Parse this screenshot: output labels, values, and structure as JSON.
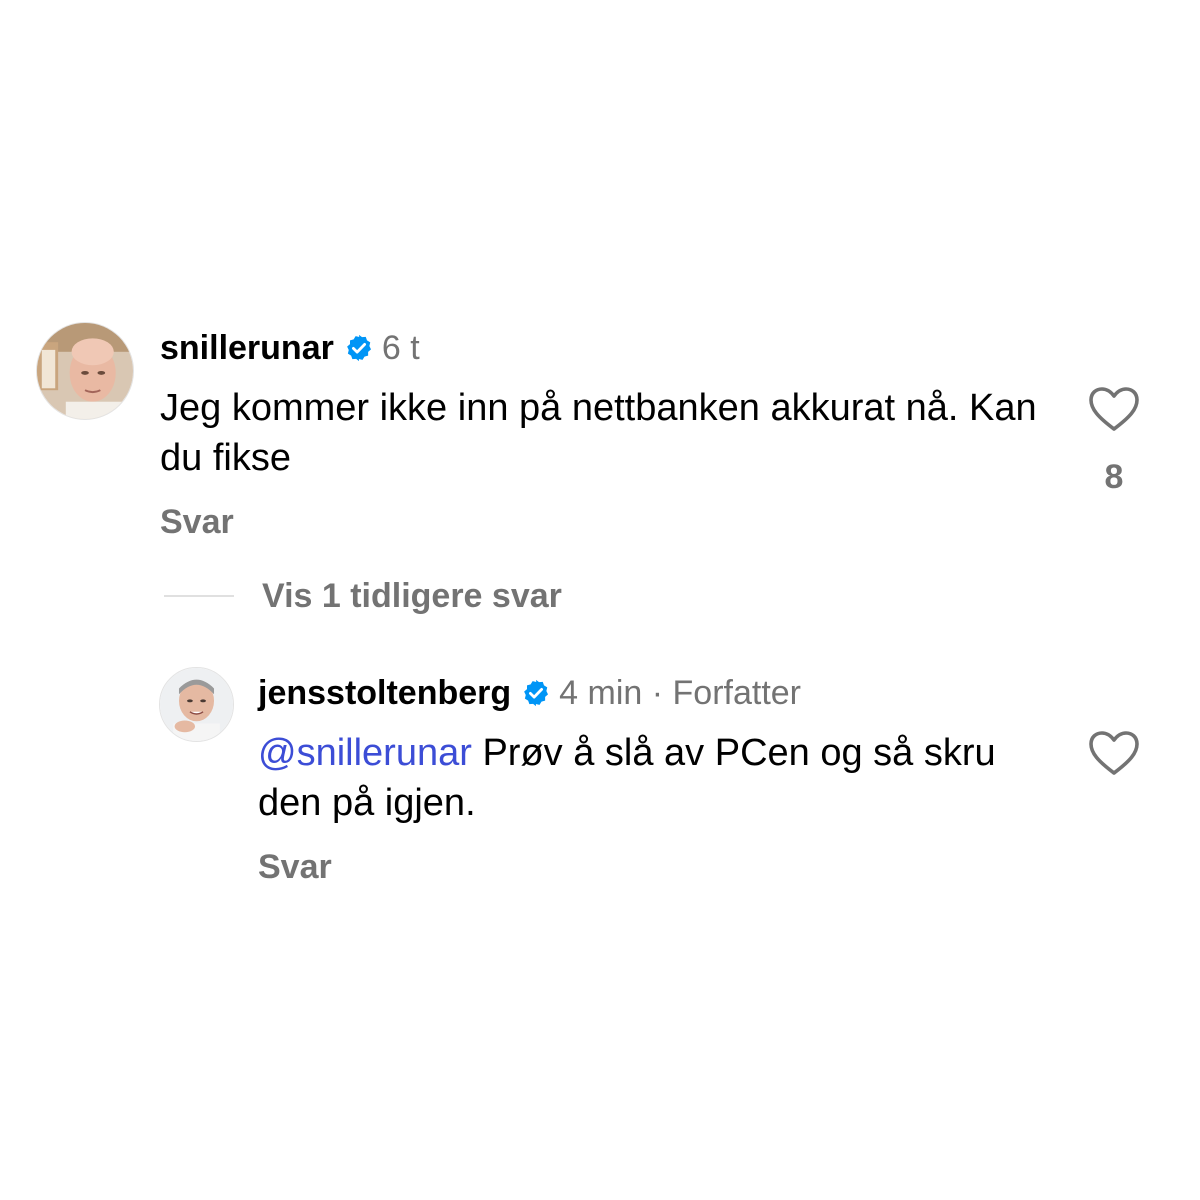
{
  "comments": [
    {
      "username": "snillerunar",
      "time": "6 t",
      "text": "Jeg kommer ikke inn på nettbanken akkurat nå. Kan du fikse",
      "reply_label": "Svar",
      "like_count": "8"
    }
  ],
  "thread": {
    "show_previous_label": "Vis 1 tidligere svar"
  },
  "replies": [
    {
      "username": "jensstoltenberg",
      "meta": "4 min · Forfatter",
      "mention": "@snillerunar",
      "text": " Prøv å slå av PCen og så skru den på igjen.",
      "reply_label": "Svar"
    }
  ],
  "colors": {
    "verified_badge": "#0095f6",
    "mention": "#3c4dd6",
    "secondary_text": "#737373"
  },
  "icons": {
    "verified": "verified-badge-icon",
    "like": "heart-outline-icon"
  }
}
